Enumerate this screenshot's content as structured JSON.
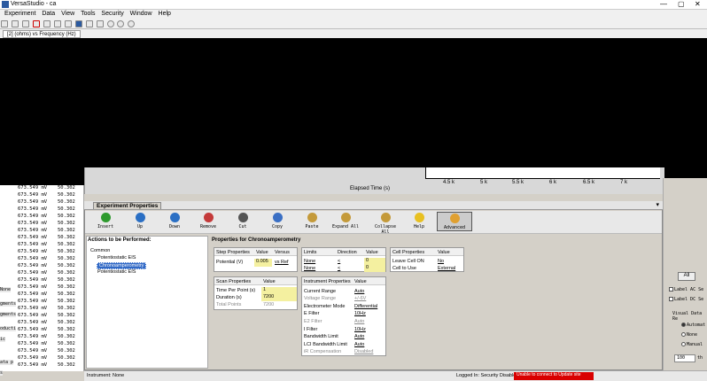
{
  "window": {
    "title": "VersaStudio - ca",
    "controls": [
      "—",
      "▢",
      "✕"
    ]
  },
  "menu": [
    "Experiment",
    "Data",
    "View",
    "Tools",
    "Security",
    "Window",
    "Help"
  ],
  "tab": {
    "label": "[2] (ohms) vs Frequency (Hz)"
  },
  "chart": {
    "x_ticks": [
      "4.5 k",
      "5 k",
      "5.5 k",
      "6 k",
      "6.5 k",
      "7 k"
    ],
    "xlabel": "Elapsed Time (s)"
  },
  "left_table": {
    "rows": [
      [
        "673.549 mV",
        "50.302"
      ],
      [
        "673.549 mV",
        "50.302"
      ],
      [
        "673.549 mV",
        "50.302"
      ],
      [
        "673.549 mV",
        "50.302"
      ],
      [
        "673.549 mV",
        "50.302"
      ],
      [
        "673.549 mV",
        "50.302"
      ],
      [
        "673.549 mV",
        "50.302"
      ],
      [
        "673.549 mV",
        "50.302"
      ],
      [
        "673.549 mV",
        "50.302"
      ],
      [
        "673.549 mV",
        "50.302"
      ],
      [
        "673.549 mV",
        "50.302"
      ],
      [
        "673.549 mV",
        "50.302"
      ],
      [
        "673.549 mV",
        "50.302"
      ],
      [
        "673.549 mV",
        "50.302"
      ],
      [
        "673.549 mV",
        "50.302"
      ],
      [
        "673.549 mV",
        "50.302"
      ],
      [
        "673.549 mV",
        "50.302"
      ],
      [
        "673.549 mV",
        "50.302"
      ],
      [
        "673.549 mV",
        "50.302"
      ],
      [
        "673.549 mV",
        "50.302"
      ],
      [
        "673.549 mV",
        "50.302"
      ],
      [
        "673.549 mV",
        "50.302"
      ],
      [
        "673.549 mV",
        "50.302"
      ],
      [
        "673.549 mV",
        "50.302"
      ],
      [
        "673.549 mV",
        "50.302"
      ],
      [
        "673.549 mV",
        "50.302"
      ]
    ],
    "side_labels": [
      "None",
      "gments",
      "gments",
      "oducti",
      "ic",
      "ata p",
      "s"
    ]
  },
  "experiment": {
    "title": "Experiment Properties",
    "toolbar": [
      {
        "label": "Insert",
        "icon": "insert-icon",
        "color": "#2e9a2e"
      },
      {
        "label": "Up",
        "icon": "up-arrow-icon",
        "color": "#2a6fc4"
      },
      {
        "label": "Down",
        "icon": "down-arrow-icon",
        "color": "#2a6fc4"
      },
      {
        "label": "Remove",
        "icon": "remove-icon",
        "color": "#c43a3a"
      },
      {
        "label": "Cut",
        "icon": "scissors-icon",
        "color": "#555555"
      },
      {
        "label": "Copy",
        "icon": "copy-icon",
        "color": "#3a6fc4"
      },
      {
        "label": "Paste",
        "icon": "paste-icon",
        "color": "#c49a3a"
      },
      {
        "label": "Expand All",
        "icon": "expand-all-icon",
        "color": "#c49a3a"
      },
      {
        "label": "Collapse All",
        "icon": "collapse-all-icon",
        "color": "#c49a3a"
      },
      {
        "label": "Help",
        "icon": "help-icon",
        "color": "#e8c020"
      },
      {
        "label": "Advanced",
        "icon": "advanced-icon",
        "color": "#e0a030"
      }
    ],
    "actions_title": "Actions to be Performed:",
    "actions": {
      "group": "Common",
      "items": [
        "Potentiostatic EIS",
        "Chronoamperometry",
        "Potentiostatic EIS"
      ]
    },
    "props_title": "Properties for Chronoamperometry",
    "step": {
      "headers": [
        "Step Properties",
        "Value",
        "Versus"
      ],
      "row": {
        "name": "Potential (V)",
        "value": "0.005",
        "versus": "vs Ref"
      }
    },
    "limits": {
      "headers": [
        "Limits",
        "Direction",
        "Value"
      ],
      "rows": [
        {
          "name": "None",
          "dir": "<",
          "value": "0"
        },
        {
          "name": "None",
          "dir": "<",
          "value": "0"
        }
      ]
    },
    "cell": {
      "headers": [
        "Cell Properties",
        "Value"
      ],
      "rows": [
        {
          "name": "Leave Cell ON",
          "value": "No"
        },
        {
          "name": "Cell to Use",
          "value": "External"
        }
      ]
    },
    "scan": {
      "headers": [
        "Scan Properties",
        "Value"
      ],
      "rows": [
        {
          "name": "Time Per Point (s)",
          "value": "1"
        },
        {
          "name": "Duration (s)",
          "value": "7200"
        },
        {
          "name": "Total Points",
          "value": "7200"
        }
      ]
    },
    "instrument": {
      "headers": [
        "Instrument Properties",
        "Value"
      ],
      "rows": [
        {
          "name": "Current Range",
          "value": "Auto"
        },
        {
          "name": "Voltage Range",
          "value": "+/-6V"
        },
        {
          "name": "Electrometer Mode",
          "value": "Differential"
        },
        {
          "name": "E Filter",
          "value": "10Hz"
        },
        {
          "name": "E2 Filter",
          "value": "Auto"
        },
        {
          "name": "I Filter",
          "value": "10Hz"
        },
        {
          "name": "Bandwidth Limit",
          "value": "Auto"
        },
        {
          "name": "LCI Bandwidth Limit",
          "value": "Auto"
        },
        {
          "name": "iR Compensation",
          "value": "Disabled"
        }
      ]
    }
  },
  "status": {
    "instrument": "Instrument: None",
    "login": "Logged In: Security Disabled",
    "error": "Unable to connect to Update site"
  },
  "right_panel": {
    "all_button": "All",
    "label_ac": "Label AC Se",
    "label_dc": "Label DC Se",
    "visual": "Visual Data Re",
    "radios": [
      "Automat",
      "None",
      "Manual"
    ],
    "num_value": "100",
    "num_suffix": "th"
  }
}
